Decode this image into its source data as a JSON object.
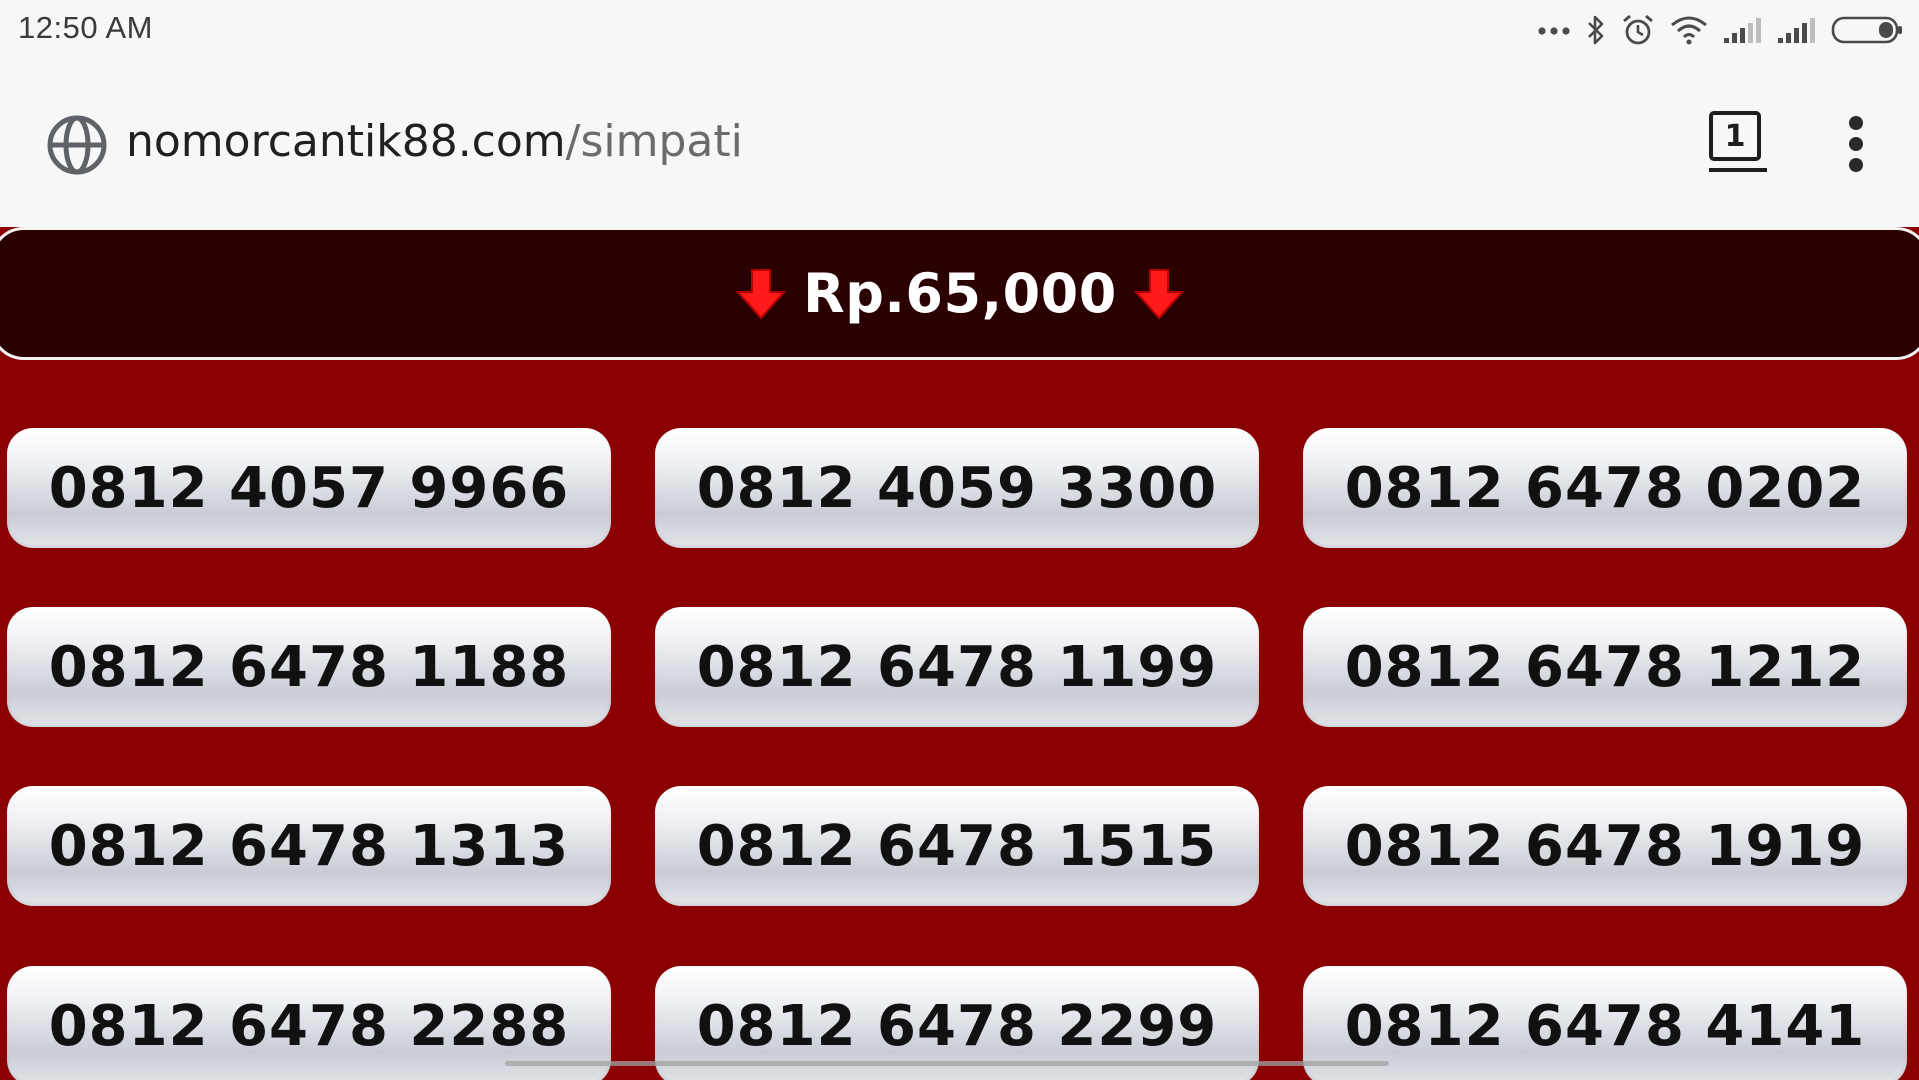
{
  "status_bar": {
    "time": "12:50 AM",
    "icons": [
      "more-dots-icon",
      "bluetooth-icon",
      "alarm-icon",
      "wifi-icon",
      "signal-sim1-icon",
      "signal-sim2-icon",
      "battery-icon"
    ]
  },
  "browser": {
    "url_domain": "nomorcantik88.com",
    "url_path": "/simpati",
    "tab_count": "1",
    "icons": [
      "globe-icon",
      "tabs-icon",
      "overflow-menu-icon"
    ]
  },
  "price_banner": {
    "label": "Rp.65,000",
    "arrow_color": "#ff1a1a"
  },
  "colors": {
    "page_background": "#8b0000",
    "banner_background": "#2a0000",
    "button_text": "#111111"
  },
  "numbers": [
    "0812 4057 9966",
    "0812 4059 3300",
    "0812 6478 0202",
    "0812 6478 1188",
    "0812 6478 1199",
    "0812 6478 1212",
    "0812 6478 1313",
    "0812 6478 1515",
    "0812 6478 1919",
    "0812 6478 2288",
    "0812 6478 2299",
    "0812 6478 4141"
  ]
}
